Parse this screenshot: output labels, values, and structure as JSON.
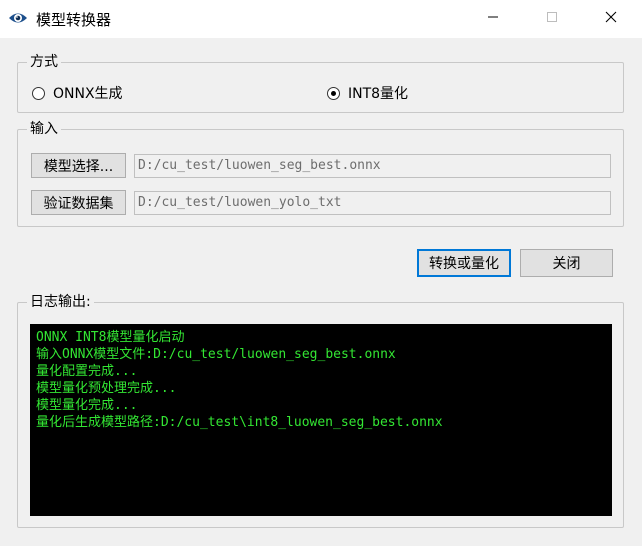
{
  "window": {
    "title": "模型转换器",
    "controls": {
      "minimize": "minimize-icon",
      "maximize": "maximize-icon",
      "close": "close-icon"
    }
  },
  "mode_group": {
    "title": "方式",
    "options": [
      {
        "label": "ONNX生成",
        "selected": false
      },
      {
        "label": "INT8量化",
        "selected": true
      }
    ]
  },
  "input_group": {
    "title": "输入",
    "model_button": "模型选择...",
    "model_path": "D:/cu_test/luowen_seg_best.onnx",
    "dataset_button": "验证数据集",
    "dataset_path": "D:/cu_test/luowen_yolo_txt"
  },
  "actions": {
    "convert": "转换或量化",
    "close": "关闭"
  },
  "log_group": {
    "title": "日志输出:",
    "lines": [
      "ONNX INT8模型量化启动",
      "输入ONNX模型文件:D:/cu_test/luowen_seg_best.onnx",
      "量化配置完成...",
      "模型量化预处理完成...",
      "模型量化完成...",
      "量化后生成模型路径:D:/cu_test\\int8_luowen_seg_best.onnx"
    ]
  },
  "colors": {
    "log_background": "#000000",
    "log_text": "#33e633",
    "dialog_background": "#f0f0f0",
    "focus_border": "#0078d7"
  }
}
